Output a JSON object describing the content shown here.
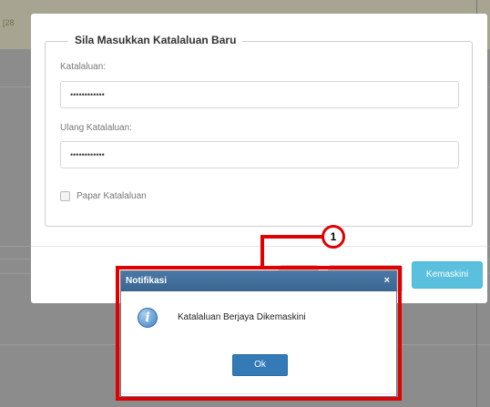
{
  "background": {
    "top_text": "[28"
  },
  "password_modal": {
    "legend": "Sila Masukkan Katalaluan Baru",
    "password_label": "Katalaluan:",
    "password_value": "••••••••••••",
    "confirm_label": "Ulang Katalaluan:",
    "confirm_value": "••••••••••••",
    "show_password_label": "Papar Katalaluan",
    "update_button": "Kemaskini"
  },
  "annotation": {
    "callout_number": "1",
    "color": "#e00000"
  },
  "notification": {
    "title": "Notifikasi",
    "close_symbol": "×",
    "icon": "info-icon",
    "icon_glyph": "i",
    "message": "Katalaluan Berjaya Dikemaskini",
    "ok_button": "Ok"
  },
  "colors": {
    "update_button": "#5bc0de",
    "ok_button": "#337ab7",
    "title_bar": "#3a6591"
  }
}
